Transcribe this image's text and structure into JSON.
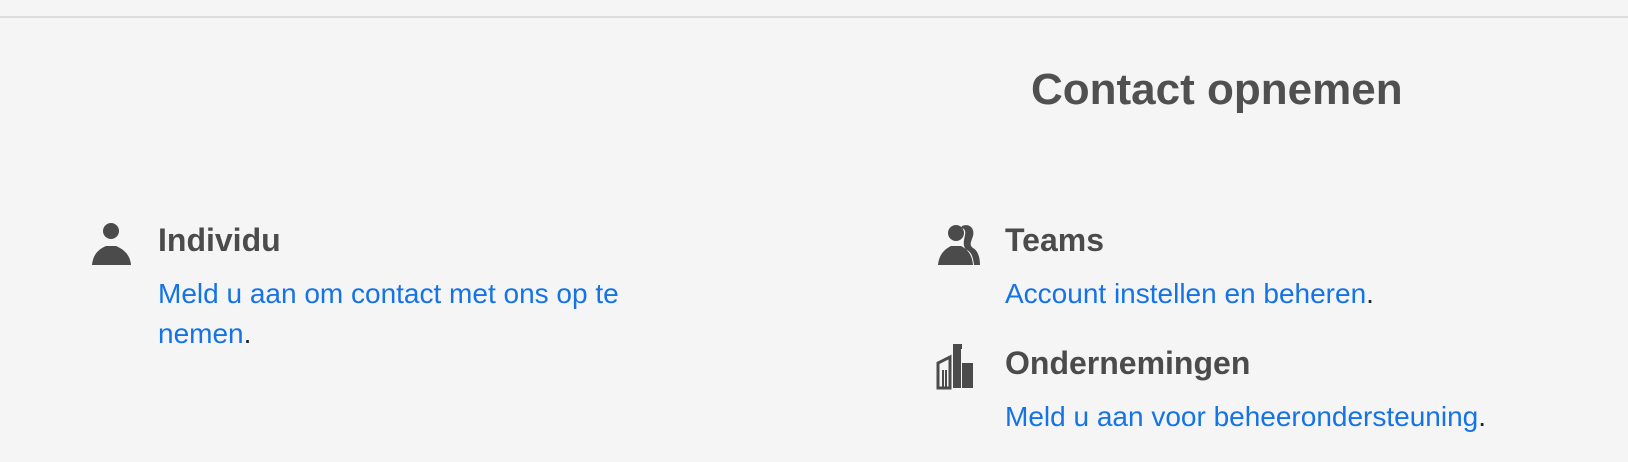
{
  "page": {
    "title": "Contact opnemen"
  },
  "individual": {
    "icon": "person-icon",
    "heading": "Individu",
    "link_text": "Meld u aan om contact met ons op te nemen",
    "suffix": "."
  },
  "teams": {
    "icon": "people-icon",
    "heading": "Teams",
    "link_text": "Account instellen en beheren",
    "suffix": "."
  },
  "enterprise": {
    "icon": "buildings-icon",
    "heading": "Ondernemingen",
    "link_text": "Meld u aan voor beheerondersteuning",
    "suffix": "."
  },
  "colors": {
    "background": "#f5f5f5",
    "heading": "#4b4b4b",
    "link": "#1473e6",
    "divider": "#dedede"
  }
}
